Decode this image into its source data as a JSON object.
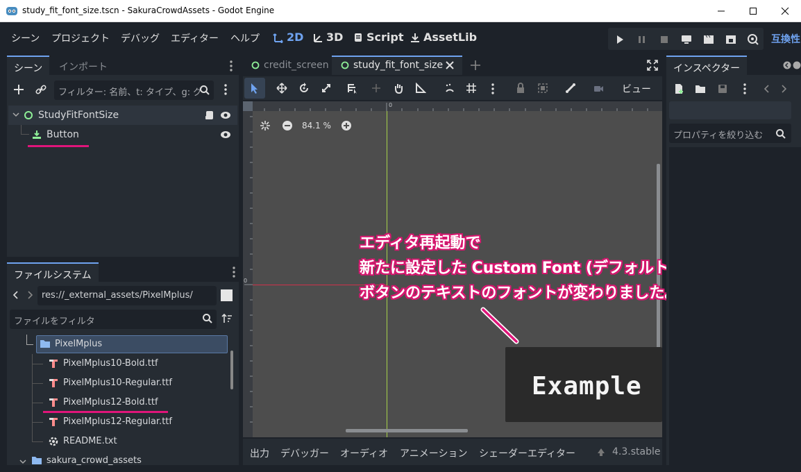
{
  "window": {
    "title": "study_fit_font_size.tscn - SakuraCrowdAssets - Godot Engine"
  },
  "menu": [
    "シーン",
    "プロジェクト",
    "デバッグ",
    "エディター",
    "ヘルプ"
  ],
  "workspaces": {
    "w2d": "2D",
    "w3d": "3D",
    "script": "Script",
    "assetlib": "AssetLib"
  },
  "compat_label": "互換性",
  "scene_panel": {
    "tabs": [
      "シーン",
      "インポート"
    ],
    "filter_placeholder": "フィルター: 名前、t: タイプ、g: グ",
    "nodes": {
      "root": "StudyFitFontSize",
      "child": "Button"
    }
  },
  "filesystem": {
    "tab": "ファイルシステム",
    "path": "res://_external_assets/PixelMplus/",
    "filter_placeholder": "ファイルをフィルタ",
    "folder": "PixelMplus",
    "files": [
      "PixelMplus10-Bold.ttf",
      "PixelMplus10-Regular.ttf",
      "PixelMplus12-Bold.ttf",
      "PixelMplus12-Regular.ttf",
      "README.txt"
    ],
    "next_folder": "sakura_crowd_assets"
  },
  "editor_tabs": [
    "credit_screen",
    "study_fit_font_size"
  ],
  "toolbar": {
    "view_label": "ビュー"
  },
  "viewport": {
    "zoom": "84.1 %",
    "ruler_zero": "0",
    "example_text": "Example"
  },
  "annotation": {
    "line1": "エディタ再起動で",
    "line2": "新たに設定した Custom Font (デフォルトのフォント) に",
    "line3": "ボタンのテキストのフォントが変わりました。"
  },
  "bottom_panel": {
    "items": [
      "出力",
      "デバッガー",
      "オーディオ",
      "アニメーション",
      "シェーダーエディター"
    ],
    "version": "4.3.stable"
  },
  "inspector": {
    "tab": "インスペクター",
    "filter_placeholder": "プロパティを絞り込む"
  },
  "colors": {
    "accent": "#6fa3f0",
    "annotation": "#e0157a",
    "node_green": "#8eef97"
  }
}
